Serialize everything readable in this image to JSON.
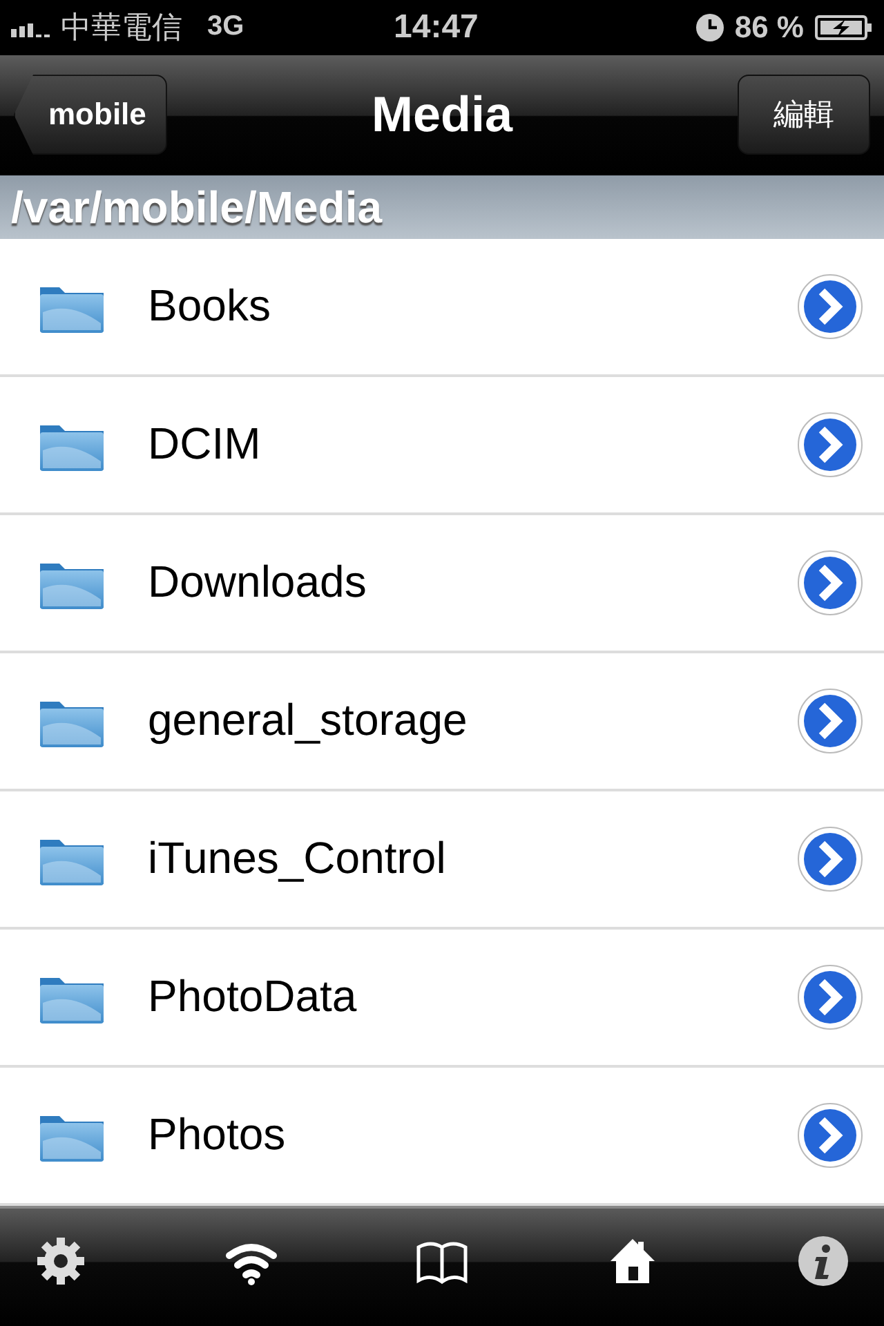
{
  "status_bar": {
    "carrier": "中華電信",
    "network": "3G",
    "time": "14:47",
    "battery": "86 %"
  },
  "nav_bar": {
    "back": "mobile",
    "title": "Media",
    "edit": "編輯"
  },
  "path": "/var/mobile/Media",
  "folders": [
    {
      "name": "Books"
    },
    {
      "name": "DCIM"
    },
    {
      "name": "Downloads"
    },
    {
      "name": "general_storage"
    },
    {
      "name": "iTunes_Control"
    },
    {
      "name": "PhotoData"
    },
    {
      "name": "Photos"
    }
  ],
  "tab_bar": [
    {
      "kind": "settings"
    },
    {
      "kind": "wifi"
    },
    {
      "kind": "book"
    },
    {
      "kind": "home"
    },
    {
      "kind": "info"
    }
  ]
}
